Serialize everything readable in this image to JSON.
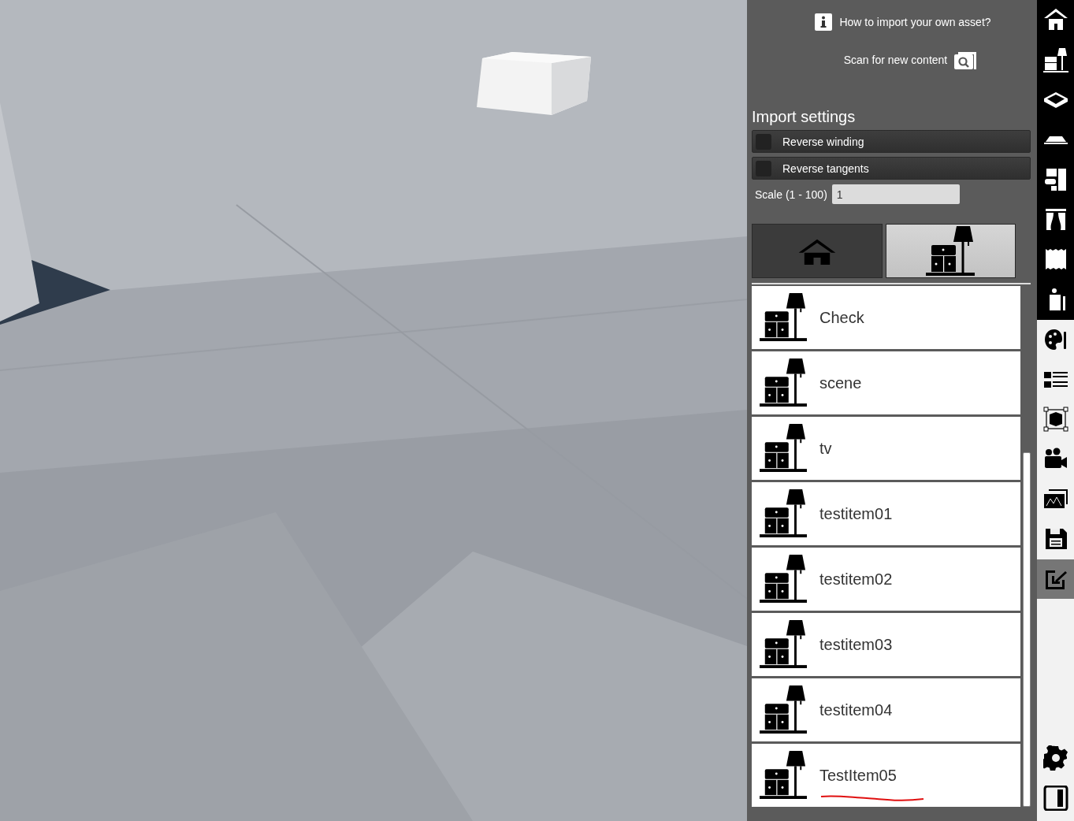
{
  "panel": {
    "help_link": "How to import your own asset?",
    "scan_button": "Scan for new content",
    "import_settings": {
      "title": "Import settings",
      "options": [
        {
          "label": "Reverse winding",
          "checked": false
        },
        {
          "label": "Reverse tangents",
          "checked": false
        }
      ],
      "scale": {
        "label": "Scale (1 - 100)",
        "value": "1"
      }
    },
    "category_tabs": [
      {
        "kind": "house",
        "selected": false
      },
      {
        "kind": "furniture",
        "selected": true
      }
    ],
    "assets": [
      {
        "name": "Check",
        "marked": false
      },
      {
        "name": "scene",
        "marked": false
      },
      {
        "name": "tv",
        "marked": false
      },
      {
        "name": "testitem01",
        "marked": false
      },
      {
        "name": "testitem02",
        "marked": false
      },
      {
        "name": "testitem03",
        "marked": false
      },
      {
        "name": "testitem04",
        "marked": false
      },
      {
        "name": "TestItem05",
        "marked": true
      }
    ]
  },
  "toolbar": {
    "sections": [
      {
        "items": [
          {
            "kind": "house",
            "selected": false
          },
          {
            "kind": "furniture",
            "selected": false
          },
          {
            "kind": "slab",
            "selected": false
          },
          {
            "kind": "roof",
            "selected": false
          },
          {
            "kind": "wall",
            "selected": false
          },
          {
            "kind": "curtain",
            "selected": false
          },
          {
            "kind": "texture",
            "selected": false
          },
          {
            "kind": "figure",
            "selected": false
          }
        ]
      },
      {
        "items": [
          {
            "kind": "palette",
            "selected": false
          },
          {
            "kind": "list",
            "selected": false
          },
          {
            "kind": "shape",
            "selected": false
          },
          {
            "kind": "camera",
            "selected": false
          },
          {
            "kind": "gallery",
            "selected": false
          },
          {
            "kind": "save",
            "selected": false
          },
          {
            "kind": "import",
            "selected": true
          }
        ]
      }
    ],
    "footer": [
      {
        "kind": "settings",
        "selected": false
      },
      {
        "kind": "panel",
        "selected": false
      }
    ]
  }
}
